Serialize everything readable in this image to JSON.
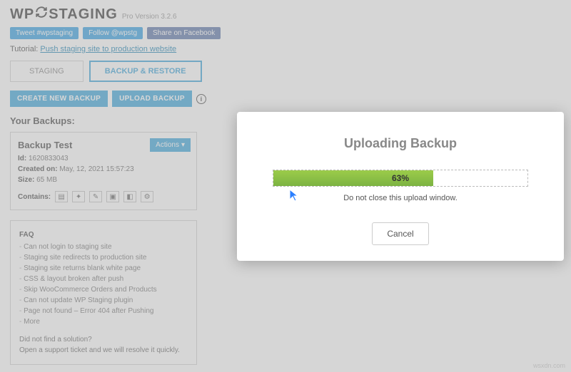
{
  "header": {
    "logo_prefix": "WP",
    "logo_suffix": "STAGING",
    "version": "Pro Version 3.2.6"
  },
  "social": {
    "tweet": "Tweet #wpstaging",
    "follow": "Follow @wpstg",
    "share": "Share on Facebook"
  },
  "tutorial": {
    "label": "Tutorial:",
    "link_text": "Push staging site to production website"
  },
  "tabs": {
    "staging": "STAGING",
    "backup": "BACKUP & RESTORE"
  },
  "actions": {
    "create": "CREATE NEW BACKUP",
    "upload": "UPLOAD BACKUP"
  },
  "section": {
    "title": "Your Backups:"
  },
  "backup": {
    "name": "Backup Test",
    "id_label": "Id:",
    "id_value": "1620833043",
    "created_label": "Created on:",
    "created_value": "May, 12, 2021 15:57:23",
    "size_label": "Size:",
    "size_value": "65 MB",
    "contains_label": "Contains:",
    "actions_label": "Actions"
  },
  "faq": {
    "title": "FAQ",
    "items": [
      "Can not login to staging site",
      "Staging site redirects to production site",
      "Staging site returns blank white page",
      "CSS & layout broken after push",
      "Skip WooCommerce Orders and Products",
      "Can not update WP Staging plugin",
      "Page not found – Error 404 after Pushing",
      "More"
    ],
    "footer_q": "Did not find a solution?",
    "footer_a": "Open a support ticket and we will resolve it quickly."
  },
  "modal": {
    "title": "Uploading Backup",
    "progress_pct": "63%",
    "note": "Do not close this upload window.",
    "cancel": "Cancel"
  },
  "watermark": "wsxdn.com"
}
